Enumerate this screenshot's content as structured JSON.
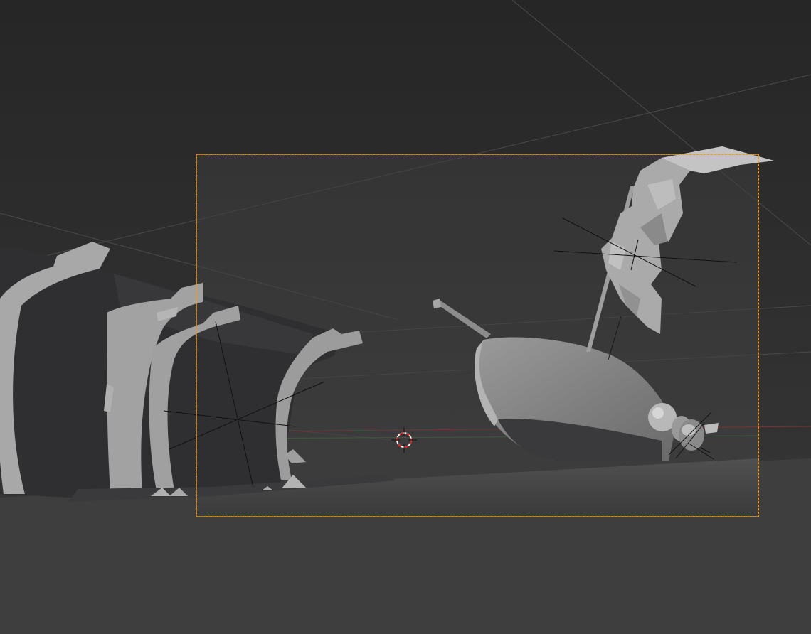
{
  "app": "3D viewport",
  "view": {
    "mode": "camera-view",
    "shading": "solid",
    "objects": [
      "wreck-hull",
      "rowboat",
      "mast",
      "sail",
      "spyglass",
      "oar",
      "3d-cursor"
    ]
  },
  "colors": {
    "background_top": "#262626",
    "background_bottom": "#3a3a3a",
    "ground": "#4a4a4a",
    "camera_frame": "#e89a2c",
    "mesh_light": "#a9a9a9",
    "mesh_dark": "#2e2e30",
    "cursor_ring_red": "#e02020",
    "cursor_ring_white": "#ffffff"
  },
  "icons": {
    "cursor": "3d-cursor-icon"
  }
}
